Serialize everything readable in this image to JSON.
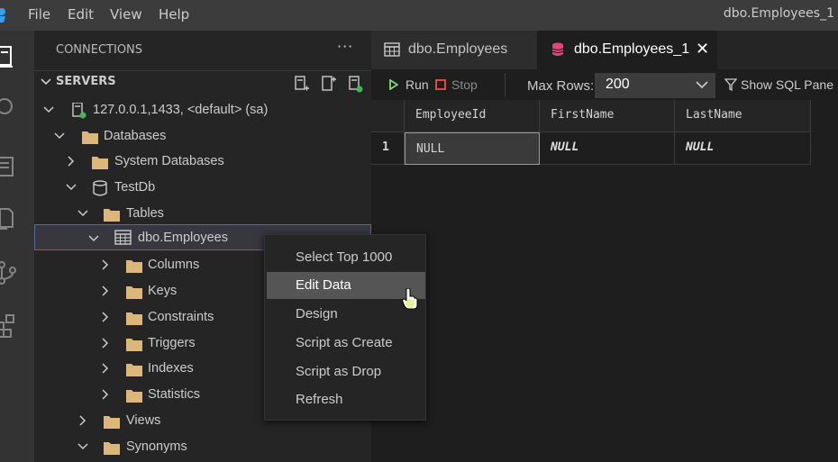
{
  "menubar": {
    "items": [
      "File",
      "Edit",
      "View",
      "Help"
    ],
    "window_title": "dbo.Employees_1"
  },
  "sidebar": {
    "header": "CONNECTIONS",
    "more": "···",
    "section_title": "SERVERS",
    "tree": [
      {
        "label": "127.0.0.1,1433, <default> (sa)",
        "icon": "server-connected-icon"
      },
      {
        "label": "Databases",
        "icon": "folder-icon"
      },
      {
        "label": "System Databases",
        "icon": "folder-icon"
      },
      {
        "label": "TestDb",
        "icon": "database-icon"
      },
      {
        "label": "Tables",
        "icon": "folder-icon"
      },
      {
        "label": "dbo.Employees",
        "icon": "table-icon"
      },
      {
        "label": "Columns",
        "icon": "folder-icon"
      },
      {
        "label": "Keys",
        "icon": "folder-icon"
      },
      {
        "label": "Constraints",
        "icon": "folder-icon"
      },
      {
        "label": "Triggers",
        "icon": "folder-icon"
      },
      {
        "label": "Indexes",
        "icon": "folder-icon"
      },
      {
        "label": "Statistics",
        "icon": "folder-icon"
      },
      {
        "label": "Views",
        "icon": "folder-icon"
      },
      {
        "label": "Synonyms",
        "icon": "folder-icon"
      }
    ]
  },
  "tabs": [
    {
      "label": "dbo.Employees",
      "active": false
    },
    {
      "label": "dbo.Employees_1",
      "active": true,
      "close": "✕"
    }
  ],
  "toolbar": {
    "run_label": "Run",
    "stop_label": "Stop",
    "max_rows_label": "Max Rows:",
    "max_rows_value": "200",
    "show_sql_label": "Show SQL Pane"
  },
  "grid": {
    "columns": [
      "EmployeeId",
      "FirstName",
      "LastName"
    ],
    "rows": [
      {
        "num": "1",
        "cells": [
          "NULL",
          "NULL",
          "NULL"
        ]
      }
    ]
  },
  "context_menu": {
    "items": [
      "Select Top 1000",
      "Edit Data",
      "Design",
      "Script as Create",
      "Script as Drop",
      "Refresh"
    ],
    "hovered": "Edit Data"
  },
  "colors": {
    "run_green": "#89d185",
    "stop_red": "#f14c4c",
    "folder": "#dcb67a",
    "active_tab_icon": "#e0457b",
    "connected_dot": "#3fb950"
  }
}
